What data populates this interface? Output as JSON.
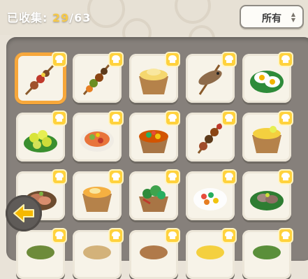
{
  "header": {
    "collected_label": "已收集: ",
    "collected_count": "29",
    "total_sep": "/",
    "total_count": "63"
  },
  "filter": {
    "selected": "所有"
  },
  "colors": {
    "accent": "#f6c948",
    "selection": "#f7a73a",
    "badge": "#ffd23d"
  },
  "recipes": [
    {
      "icon": "grilled-skewer-icon"
    },
    {
      "icon": "mushroom-skewer-icon"
    },
    {
      "icon": "mashed-potato-bowl-icon"
    },
    {
      "icon": "grilled-fish-icon"
    },
    {
      "icon": "fried-egg-leaf-icon"
    },
    {
      "icon": "lemon-leaf-icon"
    },
    {
      "icon": "fruit-salad-bowl-icon"
    },
    {
      "icon": "stew-bowl-icon"
    },
    {
      "icon": "meat-mushroom-skewer-icon"
    },
    {
      "icon": "lemon-cream-bowl-icon"
    },
    {
      "icon": "meat-platter-icon"
    },
    {
      "icon": "honey-bowl-icon"
    },
    {
      "icon": "vegetable-bowl-icon"
    },
    {
      "icon": "salad-plate-icon"
    },
    {
      "icon": "vegetable-leaf-icon"
    },
    {
      "icon": "green-dish-icon"
    },
    {
      "icon": "partial-dish-icon"
    },
    {
      "icon": "partial-dish-icon"
    },
    {
      "icon": "partial-dish-icon"
    },
    {
      "icon": "partial-dish-icon"
    }
  ]
}
